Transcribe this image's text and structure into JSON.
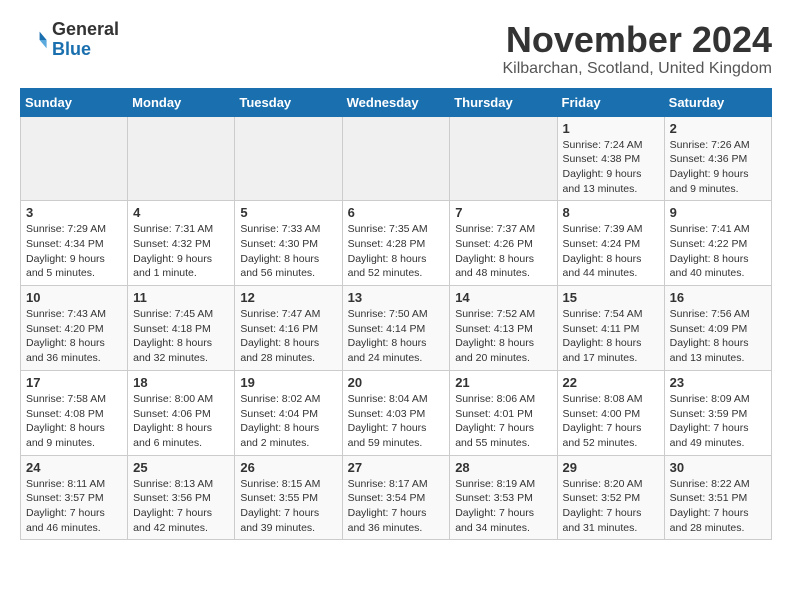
{
  "header": {
    "logo": {
      "line1": "General",
      "line2": "Blue"
    },
    "title": "November 2024",
    "location": "Kilbarchan, Scotland, United Kingdom"
  },
  "calendar": {
    "days_of_week": [
      "Sunday",
      "Monday",
      "Tuesday",
      "Wednesday",
      "Thursday",
      "Friday",
      "Saturday"
    ],
    "weeks": [
      [
        {
          "day": "",
          "info": ""
        },
        {
          "day": "",
          "info": ""
        },
        {
          "day": "",
          "info": ""
        },
        {
          "day": "",
          "info": ""
        },
        {
          "day": "",
          "info": ""
        },
        {
          "day": "1",
          "info": "Sunrise: 7:24 AM\nSunset: 4:38 PM\nDaylight: 9 hours and 13 minutes."
        },
        {
          "day": "2",
          "info": "Sunrise: 7:26 AM\nSunset: 4:36 PM\nDaylight: 9 hours and 9 minutes."
        }
      ],
      [
        {
          "day": "3",
          "info": "Sunrise: 7:29 AM\nSunset: 4:34 PM\nDaylight: 9 hours and 5 minutes."
        },
        {
          "day": "4",
          "info": "Sunrise: 7:31 AM\nSunset: 4:32 PM\nDaylight: 9 hours and 1 minute."
        },
        {
          "day": "5",
          "info": "Sunrise: 7:33 AM\nSunset: 4:30 PM\nDaylight: 8 hours and 56 minutes."
        },
        {
          "day": "6",
          "info": "Sunrise: 7:35 AM\nSunset: 4:28 PM\nDaylight: 8 hours and 52 minutes."
        },
        {
          "day": "7",
          "info": "Sunrise: 7:37 AM\nSunset: 4:26 PM\nDaylight: 8 hours and 48 minutes."
        },
        {
          "day": "8",
          "info": "Sunrise: 7:39 AM\nSunset: 4:24 PM\nDaylight: 8 hours and 44 minutes."
        },
        {
          "day": "9",
          "info": "Sunrise: 7:41 AM\nSunset: 4:22 PM\nDaylight: 8 hours and 40 minutes."
        }
      ],
      [
        {
          "day": "10",
          "info": "Sunrise: 7:43 AM\nSunset: 4:20 PM\nDaylight: 8 hours and 36 minutes."
        },
        {
          "day": "11",
          "info": "Sunrise: 7:45 AM\nSunset: 4:18 PM\nDaylight: 8 hours and 32 minutes."
        },
        {
          "day": "12",
          "info": "Sunrise: 7:47 AM\nSunset: 4:16 PM\nDaylight: 8 hours and 28 minutes."
        },
        {
          "day": "13",
          "info": "Sunrise: 7:50 AM\nSunset: 4:14 PM\nDaylight: 8 hours and 24 minutes."
        },
        {
          "day": "14",
          "info": "Sunrise: 7:52 AM\nSunset: 4:13 PM\nDaylight: 8 hours and 20 minutes."
        },
        {
          "day": "15",
          "info": "Sunrise: 7:54 AM\nSunset: 4:11 PM\nDaylight: 8 hours and 17 minutes."
        },
        {
          "day": "16",
          "info": "Sunrise: 7:56 AM\nSunset: 4:09 PM\nDaylight: 8 hours and 13 minutes."
        }
      ],
      [
        {
          "day": "17",
          "info": "Sunrise: 7:58 AM\nSunset: 4:08 PM\nDaylight: 8 hours and 9 minutes."
        },
        {
          "day": "18",
          "info": "Sunrise: 8:00 AM\nSunset: 4:06 PM\nDaylight: 8 hours and 6 minutes."
        },
        {
          "day": "19",
          "info": "Sunrise: 8:02 AM\nSunset: 4:04 PM\nDaylight: 8 hours and 2 minutes."
        },
        {
          "day": "20",
          "info": "Sunrise: 8:04 AM\nSunset: 4:03 PM\nDaylight: 7 hours and 59 minutes."
        },
        {
          "day": "21",
          "info": "Sunrise: 8:06 AM\nSunset: 4:01 PM\nDaylight: 7 hours and 55 minutes."
        },
        {
          "day": "22",
          "info": "Sunrise: 8:08 AM\nSunset: 4:00 PM\nDaylight: 7 hours and 52 minutes."
        },
        {
          "day": "23",
          "info": "Sunrise: 8:09 AM\nSunset: 3:59 PM\nDaylight: 7 hours and 49 minutes."
        }
      ],
      [
        {
          "day": "24",
          "info": "Sunrise: 8:11 AM\nSunset: 3:57 PM\nDaylight: 7 hours and 46 minutes."
        },
        {
          "day": "25",
          "info": "Sunrise: 8:13 AM\nSunset: 3:56 PM\nDaylight: 7 hours and 42 minutes."
        },
        {
          "day": "26",
          "info": "Sunrise: 8:15 AM\nSunset: 3:55 PM\nDaylight: 7 hours and 39 minutes."
        },
        {
          "day": "27",
          "info": "Sunrise: 8:17 AM\nSunset: 3:54 PM\nDaylight: 7 hours and 36 minutes."
        },
        {
          "day": "28",
          "info": "Sunrise: 8:19 AM\nSunset: 3:53 PM\nDaylight: 7 hours and 34 minutes."
        },
        {
          "day": "29",
          "info": "Sunrise: 8:20 AM\nSunset: 3:52 PM\nDaylight: 7 hours and 31 minutes."
        },
        {
          "day": "30",
          "info": "Sunrise: 8:22 AM\nSunset: 3:51 PM\nDaylight: 7 hours and 28 minutes."
        }
      ]
    ]
  }
}
